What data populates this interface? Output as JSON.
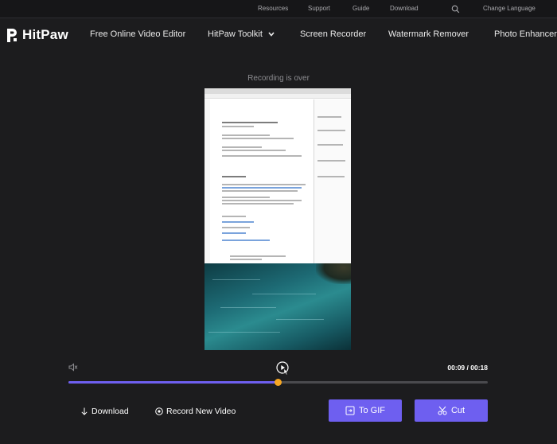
{
  "topbar": {
    "links": [
      "Resources",
      "Support",
      "Guide",
      "Download"
    ],
    "language": "Change Language"
  },
  "nav": {
    "brand": "HitPaw",
    "items": [
      "Free Online Video Editor",
      "HitPaw Toolkit",
      "Screen Recorder",
      "Watermark Remover",
      "Photo Enhancer"
    ]
  },
  "recording": {
    "status": "Recording is over"
  },
  "player": {
    "time": "00:09 / 00:18",
    "progress": 0.5,
    "accent": "#6e5ff0",
    "thumb_color": "#f5a623"
  },
  "actions": {
    "download": "Download",
    "record_new": "Record New Video",
    "to_gif": "To GIF",
    "cut": "Cut"
  }
}
